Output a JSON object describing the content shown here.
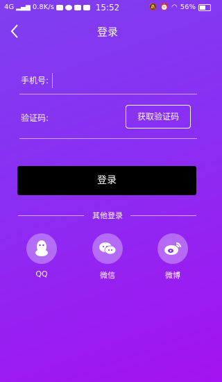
{
  "status": {
    "network": "4G",
    "speed": "0.8K/s",
    "time": "15:52",
    "battery": "56%"
  },
  "header": {
    "title": "登录"
  },
  "form": {
    "phone_label": "手机号:",
    "phone_value": "",
    "code_label": "验证码:",
    "code_button": "获取验证码"
  },
  "login_button": "登录",
  "other_login": {
    "title": "其他登录",
    "items": [
      {
        "label": "QQ",
        "icon": "qq-icon"
      },
      {
        "label": "微信",
        "icon": "wechat-icon"
      },
      {
        "label": "微博",
        "icon": "weibo-icon"
      }
    ]
  }
}
